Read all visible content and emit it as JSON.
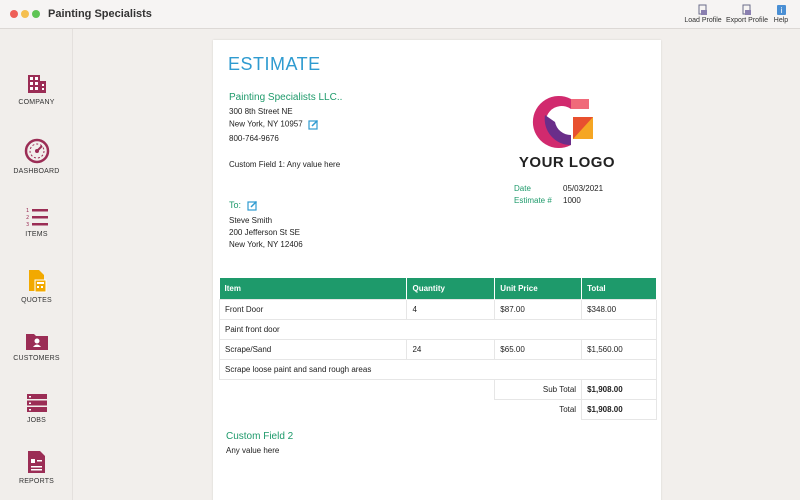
{
  "window": {
    "title": "Painting Specialists"
  },
  "toolbar": {
    "load_profile": "Load Profile",
    "export_profile": "Export Profile",
    "help": "Help"
  },
  "sidebar": {
    "items": [
      {
        "label": "COMPANY",
        "icon": "building-icon"
      },
      {
        "label": "DASHBOARD",
        "icon": "gauge-icon"
      },
      {
        "label": "ITEMS",
        "icon": "numbered-list-icon"
      },
      {
        "label": "QUOTES",
        "icon": "document-calculator-icon"
      },
      {
        "label": "CUSTOMERS",
        "icon": "folder-person-icon"
      },
      {
        "label": "JOBS",
        "icon": "stacked-bars-icon"
      },
      {
        "label": "REPORTS",
        "icon": "report-icon"
      }
    ]
  },
  "estimate": {
    "title": "ESTIMATE",
    "company": {
      "name": "Painting Specialists LLC..",
      "address1": "300 8th Street NE",
      "address2": "New York, NY 10957",
      "phone": "800-764-9676",
      "custom_field_1": "Custom Field 1: Any value here"
    },
    "logo_text": "YOUR LOGO",
    "to": {
      "label": "To:",
      "name": "Steve Smith",
      "address1": "200 Jefferson St SE",
      "address2": "New York, NY 12406"
    },
    "meta": {
      "date_label": "Date",
      "date_value": "05/03/2021",
      "number_label": "Estimate #",
      "number_value": "1000"
    },
    "table": {
      "headers": [
        "Item",
        "Quantity",
        "Unit Price",
        "Total"
      ],
      "rows": [
        {
          "item": "Front Door",
          "quantity": "4",
          "unit_price": "$87.00",
          "total": "$348.00",
          "description": "Paint front door"
        },
        {
          "item": "Scrape/Sand",
          "quantity": "24",
          "unit_price": "$65.00",
          "total": "$1,560.00",
          "description": "Scrape loose paint and sand rough areas"
        }
      ],
      "subtotal_label": "Sub Total",
      "subtotal_value": "$1,908.00",
      "total_label": "Total",
      "total_value": "$1,908.00"
    },
    "custom_field_2": {
      "label": "Custom Field 2",
      "value": "Any value here"
    }
  },
  "colors": {
    "accent_green": "#1e9a6b",
    "title_blue": "#2f9bd0",
    "sidebar_icon": "#9b2d55"
  }
}
